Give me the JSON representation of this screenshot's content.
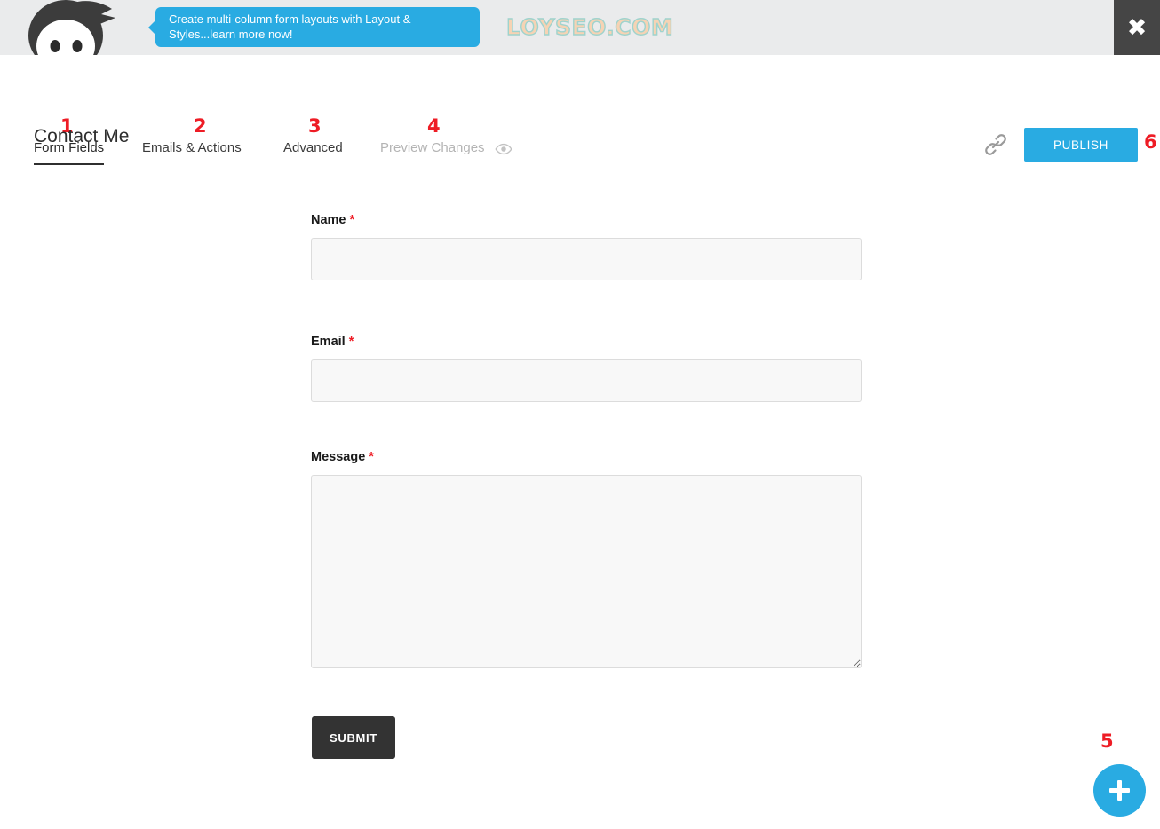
{
  "header": {
    "mascot_icon": "ninja-mascot-icon",
    "tip_bubble": {
      "line1": "Create multi-column form layouts with Layout &",
      "line2": "Styles...learn more now!",
      "background": "#29abe2"
    },
    "watermark": "LOYSEO.COM",
    "close_label": "✖",
    "background": "#eaebec"
  },
  "tabs": [
    {
      "label": "Form Fields",
      "state": "active",
      "annotation": "1"
    },
    {
      "label": "Emails & Actions",
      "state": "default",
      "annotation": "2"
    },
    {
      "label": "Advanced",
      "state": "default",
      "annotation": "3"
    },
    {
      "label": "Preview Changes",
      "state": "disabled",
      "annotation": "4",
      "icon": "eye-icon"
    }
  ],
  "toolbar": {
    "link_icon": "link-chain-icon",
    "publish_label": "PUBLISH",
    "publish_annotation": "6",
    "publish_color": "#29abe2"
  },
  "form": {
    "title": "Contact Me",
    "fields": [
      {
        "label": "Name",
        "required": "*",
        "type": "text",
        "value": "",
        "placeholder": ""
      },
      {
        "label": "Email",
        "required": "*",
        "type": "text",
        "value": "",
        "placeholder": ""
      },
      {
        "label": "Message",
        "required": "*",
        "type": "textarea",
        "value": "",
        "placeholder": ""
      }
    ],
    "submit_label": "SUBMIT"
  },
  "fab": {
    "icon": "plus-icon",
    "annotation": "5",
    "color": "#29abe2"
  }
}
